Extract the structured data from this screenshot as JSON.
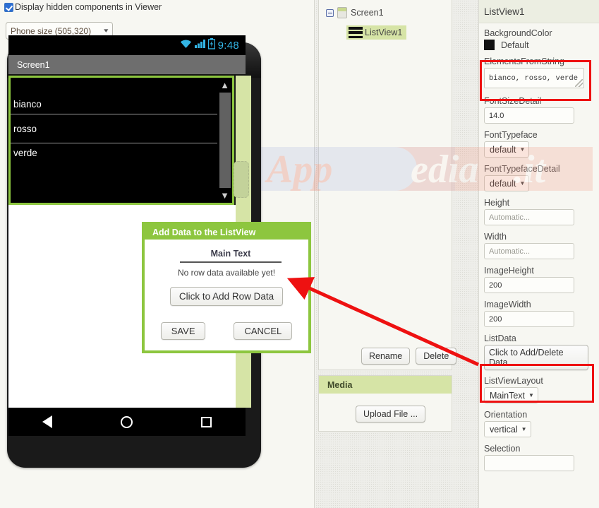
{
  "viewer": {
    "hidden_components_label": "Display hidden components in Viewer",
    "checkbox_checked": true,
    "phone_size": "Phone size (505,320)",
    "phone": {
      "status_clock": "9:48",
      "status_icons": [
        "wifi-icon",
        "signal-icon",
        "battery-icon"
      ],
      "title_bar": "Screen1",
      "listview_items": [
        "bianco",
        "rosso",
        "verde"
      ],
      "nav_icons": [
        "back-icon",
        "home-icon",
        "recents-icon"
      ]
    },
    "dialog": {
      "header": "Add Data to the ListView",
      "section_label": "Main Text",
      "empty_message": "No row data available yet!",
      "add_row_button": "Click to Add Row Data",
      "save_button": "SAVE",
      "cancel_button": "CANCEL"
    }
  },
  "components": {
    "tree": [
      {
        "label": "Screen1",
        "icon": "screen-icon",
        "expanded": true
      },
      {
        "label": "ListView1",
        "icon": "listview-icon",
        "selected": true
      }
    ],
    "rename_button": "Rename",
    "delete_button": "Delete",
    "media_header": "Media",
    "upload_button": "Upload File ..."
  },
  "properties": {
    "title": "ListView1",
    "background_color_label": "BackgroundColor",
    "background_color_value": "Default",
    "background_color_hex": "#111111",
    "elements_from_string_label": "ElementsFromString",
    "elements_from_string_value": "bianco, rosso, verde",
    "font_size_detail_label": "FontSizeDetail",
    "font_size_detail_value": "14.0",
    "font_typeface_label": "FontTypeface",
    "font_typeface_value": "default",
    "font_typeface_detail_label": "FontTypefaceDetail",
    "font_typeface_detail_value": "default",
    "height_label": "Height",
    "height_value": "Automatic...",
    "width_label": "Width",
    "width_value": "Automatic...",
    "image_height_label": "ImageHeight",
    "image_height_value": "200",
    "image_width_label": "ImageWidth",
    "image_width_value": "200",
    "list_data_label": "ListData",
    "list_data_button": "Click to Add/Delete Data",
    "listview_layout_label": "ListViewLayout",
    "listview_layout_value": "MainText",
    "orientation_label": "Orientation",
    "orientation_value": "vertical",
    "selection_label": "Selection",
    "selection_value": ""
  },
  "annotations": {
    "highlight_color": "#ee1111",
    "highlighted": [
      "ElementsFromString",
      "ListData"
    ],
    "arrow": "points from ListData property to the Add Data dialog"
  },
  "watermark": {
    "text": "Appcpedia.it"
  },
  "theme": {
    "accent_green": "#8dc63f",
    "panel_green": "#d6e4a6",
    "status_blue": "#33b5e5"
  }
}
